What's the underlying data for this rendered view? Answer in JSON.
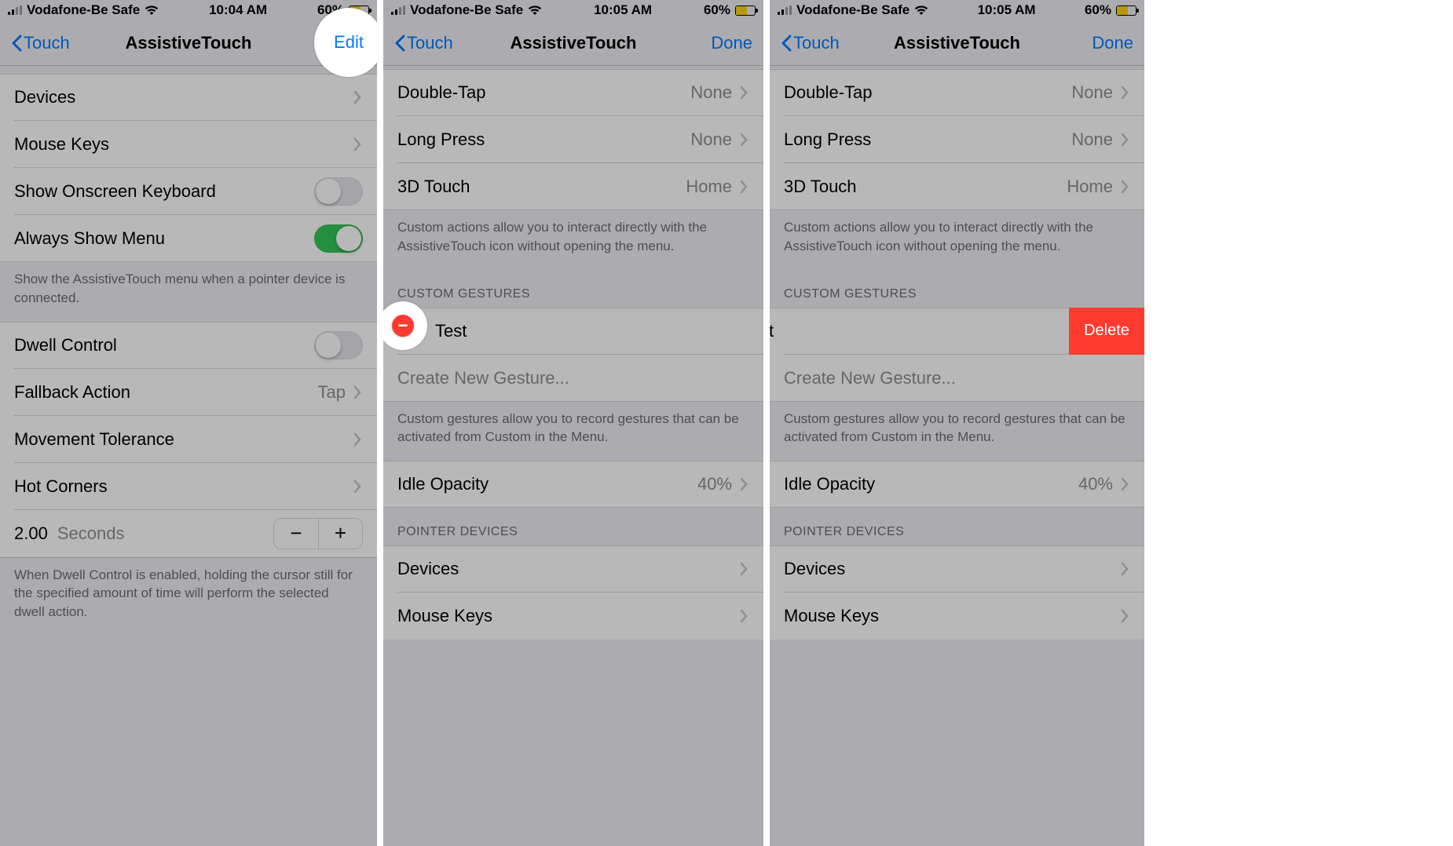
{
  "status": {
    "carrier": "Vodafone-Be Safe",
    "time1": "10:04 AM",
    "time2": "10:05 AM",
    "battery_pct": "60%"
  },
  "nav": {
    "back": "Touch",
    "title": "AssistiveTouch",
    "edit": "Edit",
    "done": "Done"
  },
  "panel1": {
    "rows": {
      "devices": "Devices",
      "mouse_keys": "Mouse Keys",
      "show_kb": "Show Onscreen Keyboard",
      "always_menu": "Always Show Menu",
      "dwell": "Dwell Control",
      "fallback": "Fallback Action",
      "fallback_val": "Tap",
      "move_tol": "Movement Tolerance",
      "hot": "Hot Corners",
      "time_val": "2.00",
      "time_unit": "Seconds"
    },
    "footer1": "Show the AssistiveTouch menu when a pointer device is connected.",
    "footer2": "When Dwell Control is enabled, holding the cursor still for the specified amount of time will perform the selected dwell action."
  },
  "panel2": {
    "rows": {
      "double_tap": "Double-Tap",
      "long_press": "Long Press",
      "td_touch": "3D Touch",
      "none": "None",
      "home": "Home",
      "gesture": "Test",
      "create": "Create New Gesture...",
      "idle": "Idle Opacity",
      "idle_val": "40%",
      "devices": "Devices",
      "mouse_keys": "Mouse Keys"
    },
    "footer_actions": "Custom actions allow you to interact directly with the AssistiveTouch icon without opening the menu.",
    "header_gestures": "CUSTOM GESTURES",
    "footer_gestures": "Custom gestures allow you to record gestures that can be activated from Custom in the Menu.",
    "header_pointer": "POINTER DEVICES"
  },
  "panel3": {
    "delete": "Delete",
    "gesture_tail": "st"
  }
}
